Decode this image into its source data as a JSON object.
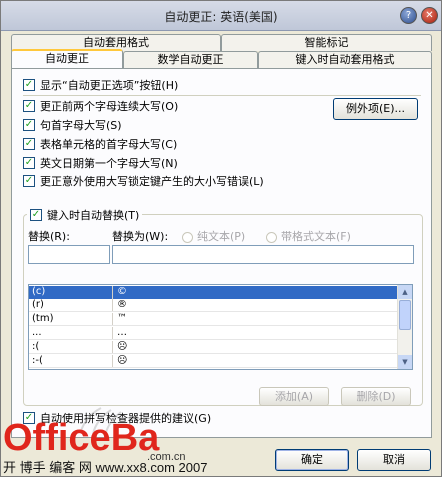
{
  "window": {
    "title": "自动更正: 英语(美国)"
  },
  "tabs": {
    "back": [
      {
        "label": "自动套用格式"
      },
      {
        "label": "智能标记"
      }
    ],
    "front": [
      {
        "label": "自动更正"
      },
      {
        "label": "数学自动更正"
      },
      {
        "label": "键入时自动套用格式"
      }
    ]
  },
  "options": {
    "show_buttons": "显示“自动更正选项”按钮(H)",
    "items": [
      {
        "label": "更正前两个字母连续大写(O)",
        "checked": true
      },
      {
        "label": "句首字母大写(S)",
        "checked": true
      },
      {
        "label": "表格单元格的首字母大写(C)",
        "checked": true
      },
      {
        "label": "英文日期第一个字母大写(N)",
        "checked": true
      },
      {
        "label": "更正意外使用大写锁定键产生的大小写错误(L)",
        "checked": true
      }
    ],
    "exceptions_button": "例外项(E)..."
  },
  "replace": {
    "group_label": "键入时自动替换(T)",
    "replace_label": "替换(R):",
    "with_label": "替换为(W):",
    "plain_text": "纯文本(P)",
    "formatted_text": "带格式文本(F)",
    "replace_value": "",
    "with_value": "",
    "rows": [
      {
        "from": "(c)",
        "to": "©",
        "selected": true
      },
      {
        "from": "(r)",
        "to": "®"
      },
      {
        "from": "(tm)",
        "to": "™"
      },
      {
        "from": "...",
        "to": "…"
      },
      {
        "from": ":(",
        "to": "☹"
      },
      {
        "from": ":-(",
        "to": "☹"
      }
    ],
    "add_button": "添加(A)",
    "delete_button": "删除(D)",
    "spellcheck_label": "自动使用拼写检查器提供的建议(G)"
  },
  "footer": {
    "ok_button": "确定",
    "cancel_button": "取消"
  },
  "watermark": {
    "brand": "OfficeBa",
    "domain": ".com.cn",
    "line": "开 博手 编客 网  www.xx8.com  2007"
  },
  "colors": {
    "accent": "#316ac5",
    "tab_highlight": "#ffc83c",
    "dialog_bg": "#ece9d8"
  }
}
